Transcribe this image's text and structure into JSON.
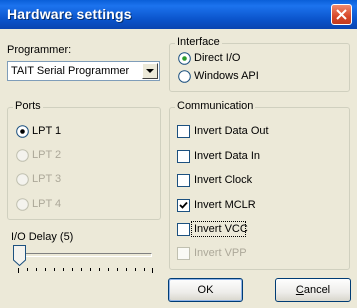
{
  "window": {
    "title": "Hardware settings"
  },
  "programmer": {
    "label": "Programmer:",
    "selected": "TAIT Serial Programmer"
  },
  "interface": {
    "title": "Interface",
    "options": [
      {
        "label": "Direct I/O",
        "selected": true
      },
      {
        "label": "Windows API",
        "selected": false
      }
    ]
  },
  "ports": {
    "title": "Ports",
    "options": [
      {
        "label": "LPT 1",
        "selected": true,
        "enabled": true
      },
      {
        "label": "LPT 2",
        "selected": false,
        "enabled": false
      },
      {
        "label": "LPT 3",
        "selected": false,
        "enabled": false
      },
      {
        "label": "LPT 4",
        "selected": false,
        "enabled": false
      }
    ]
  },
  "communication": {
    "title": "Communication",
    "options": [
      {
        "label": "Invert Data Out",
        "checked": false,
        "enabled": true
      },
      {
        "label": "Invert Data In",
        "checked": false,
        "enabled": true
      },
      {
        "label": "Invert Clock",
        "checked": false,
        "enabled": true
      },
      {
        "label": "Invert MCLR",
        "checked": true,
        "enabled": true
      },
      {
        "label": "Invert VCC",
        "checked": false,
        "enabled": true
      },
      {
        "label": "Invert VPP",
        "checked": false,
        "enabled": false
      }
    ]
  },
  "io_delay": {
    "label": "I/O Delay (5)",
    "value": 5
  },
  "buttons": {
    "ok": "OK",
    "cancel_rest": "ancel",
    "cancel_mnemonic": "C"
  }
}
